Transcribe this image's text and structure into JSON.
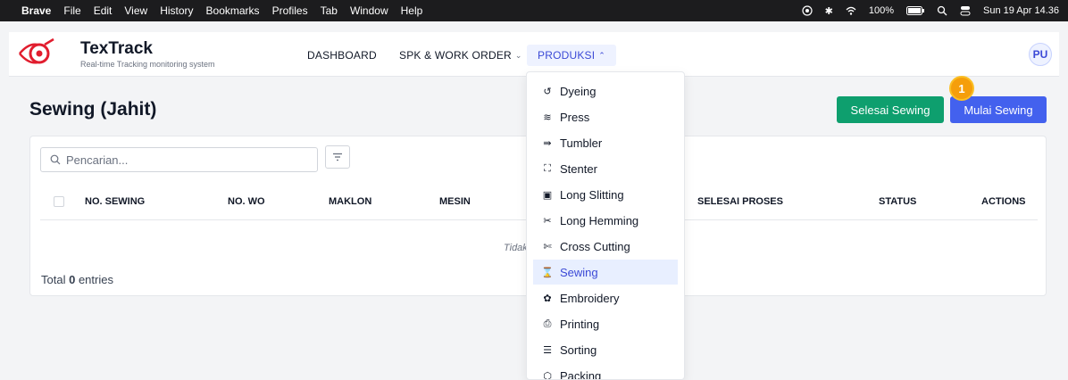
{
  "menubar": {
    "app": "Brave",
    "items": [
      "File",
      "Edit",
      "View",
      "History",
      "Bookmarks",
      "Profiles",
      "Tab",
      "Window",
      "Help"
    ],
    "battery": "100%",
    "clock": "Sun 19 Apr 14.36"
  },
  "brand": {
    "title": "TexTrack",
    "subtitle": "Real-time Tracking monitoring system"
  },
  "nav": {
    "dashboard": "DASHBOARD",
    "spk": "SPK & WORK ORDER",
    "produksi": "PRODUKSI",
    "avatar": "PU"
  },
  "page": {
    "title": "Sewing (Jahit)",
    "btn_selesai": "Selesai Sewing",
    "btn_mulai": "Mulai Sewing",
    "annotation_badge": "1"
  },
  "table": {
    "search_placeholder": "Pencarian...",
    "headers": [
      "NO. SEWING",
      "NO. WO",
      "MAKLON",
      "MESIN",
      "SELESAI PROSES",
      "STATUS",
      "ACTIONS"
    ],
    "empty_text": "Tidak",
    "total_prefix": "Total",
    "total_count": "0",
    "total_suffix": "entries"
  },
  "dropdown": {
    "items": [
      {
        "label": "Dyeing",
        "icon": "dye-icon"
      },
      {
        "label": "Press",
        "icon": "press-icon"
      },
      {
        "label": "Tumbler",
        "icon": "tumbler-icon"
      },
      {
        "label": "Stenter",
        "icon": "stenter-icon"
      },
      {
        "label": "Long Slitting",
        "icon": "slitting-icon"
      },
      {
        "label": "Long Hemming",
        "icon": "scissors-icon"
      },
      {
        "label": "Cross Cutting",
        "icon": "cutting-icon"
      },
      {
        "label": "Sewing",
        "icon": "sewing-icon"
      },
      {
        "label": "Embroidery",
        "icon": "embroidery-icon"
      },
      {
        "label": "Printing",
        "icon": "printer-icon"
      },
      {
        "label": "Sorting",
        "icon": "sorting-icon"
      },
      {
        "label": "Packing",
        "icon": "packing-icon"
      }
    ],
    "active": "Sewing"
  },
  "colors": {
    "accent": "#3b49d6",
    "green": "#0e9f6e",
    "blue": "#4361ee",
    "badge": "#f59e0b",
    "logo": "#e11d2e"
  }
}
